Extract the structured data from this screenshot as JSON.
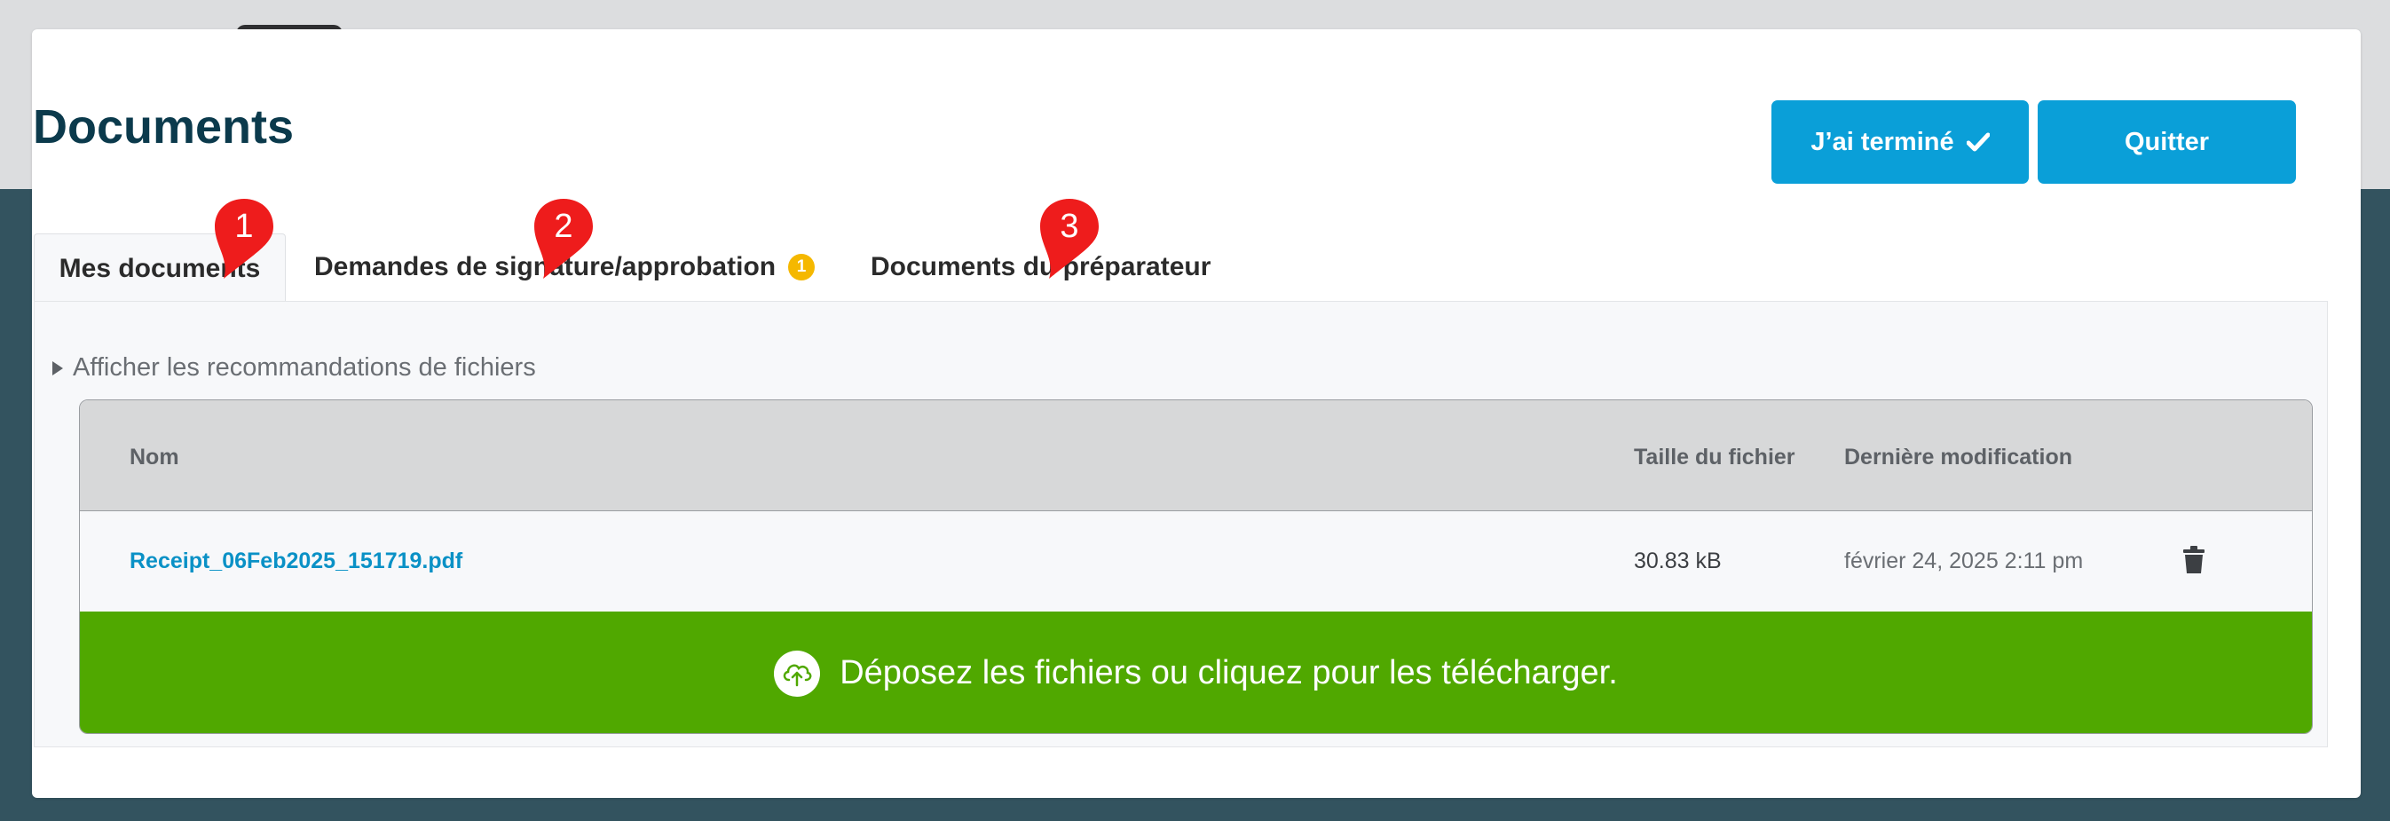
{
  "page": {
    "title": "Documents"
  },
  "actions": {
    "done_label": "J’ai terminé",
    "quit_label": "Quitter"
  },
  "tabs": [
    {
      "label": "Mes documents",
      "marker": "1"
    },
    {
      "label": "Demandes de signature/approbation",
      "badge": "1",
      "marker": "2"
    },
    {
      "label": "Documents du préparateur",
      "marker": "3"
    }
  ],
  "recommendations": {
    "label": "Afficher les recommandations de fichiers"
  },
  "table": {
    "columns": {
      "name": "Nom",
      "size": "Taille du fichier",
      "modified": "Dernière modification"
    },
    "rows": [
      {
        "name": "Receipt_06Feb2025_151719.pdf",
        "size": "30.83 kB",
        "modified": "février 24, 2025 2:11 pm"
      }
    ]
  },
  "dropzone": {
    "label": "Déposez les fichiers ou cliquez pour les télécharger."
  },
  "colors": {
    "accent_blue": "#0a9fd8",
    "title_navy": "#0b3a4c",
    "dropzone_green": "#50a800",
    "badge_yellow": "#f5b800",
    "marker_red": "#ee1c1c",
    "backdrop_teal": "#33535f"
  },
  "icons": {
    "done": "check-icon",
    "expand": "triangle-right-icon",
    "delete": "trash-icon",
    "upload": "cloud-upload-icon",
    "markers": "map-pin-icon"
  }
}
